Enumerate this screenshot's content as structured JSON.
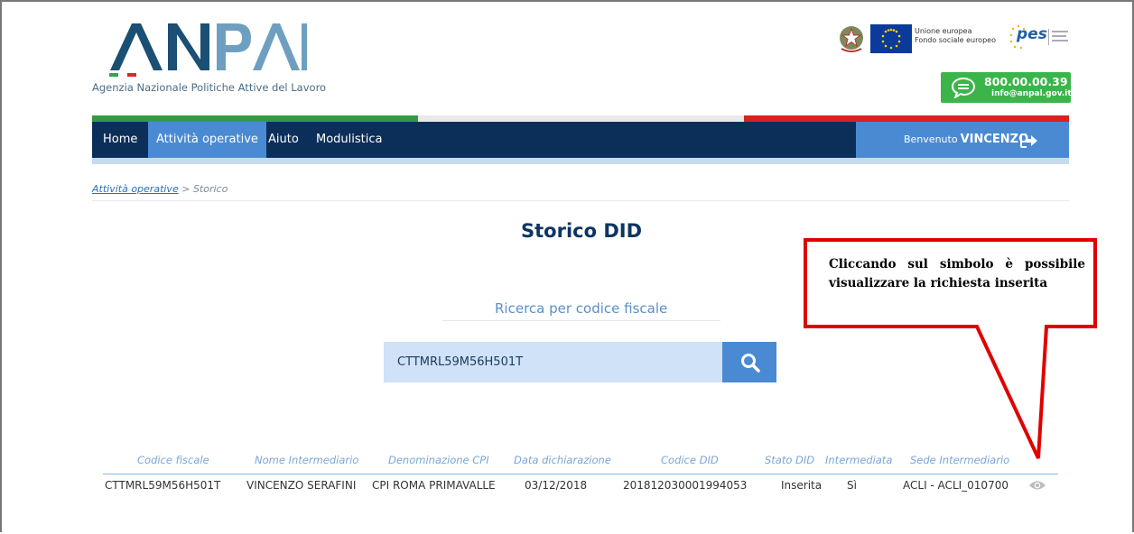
{
  "header": {
    "logo_text": "ANPAL",
    "logo_subtitle": "Agenzia Nazionale Politiche Attive del Lavoro",
    "eu_text_line1": "Unione europea",
    "eu_text_line2": "Fondo sociale europeo",
    "pes_text": "pes",
    "contact_phone": "800.00.00.39",
    "contact_email": "info@anpal.gov.it"
  },
  "colors": {
    "nav_bg": "#0c2f5a",
    "accent_blue": "#4a8ad3",
    "green": "#3bb54a",
    "title": "#0d3561",
    "callout_red": "#e00000"
  },
  "nav": {
    "items": [
      {
        "label": "Home"
      },
      {
        "label": "Attività operative"
      },
      {
        "label": "Aiuto"
      },
      {
        "label": "Modulistica"
      }
    ],
    "welcome": "Benvenuto",
    "user": "VINCENZO"
  },
  "breadcrumb": {
    "link": "Attività operative",
    "separator": ">",
    "current": "Storico"
  },
  "page_title": "Storico DID",
  "search": {
    "label": "Ricerca per codice fiscale",
    "value": "CTTMRL59M56H501T"
  },
  "table": {
    "headers": [
      "Codice fiscale",
      "Nome Intermediario",
      "Denominazione CPI",
      "Data dichiarazione",
      "Codice DID",
      "Stato DID",
      "Intermediata",
      "Sede Intermediario"
    ],
    "rows": [
      [
        "CTTMRL59M56H501T",
        "VINCENZO SERAFINI",
        "CPI ROMA PRIMAVALLE",
        "03/12/2018",
        "201812030001994053",
        "Inserita",
        "Sì",
        "ACLI - ACLI_010700"
      ]
    ]
  },
  "annotation": {
    "text": "Cliccando sul simbolo è possibile visualizzare la richiesta inserita"
  }
}
